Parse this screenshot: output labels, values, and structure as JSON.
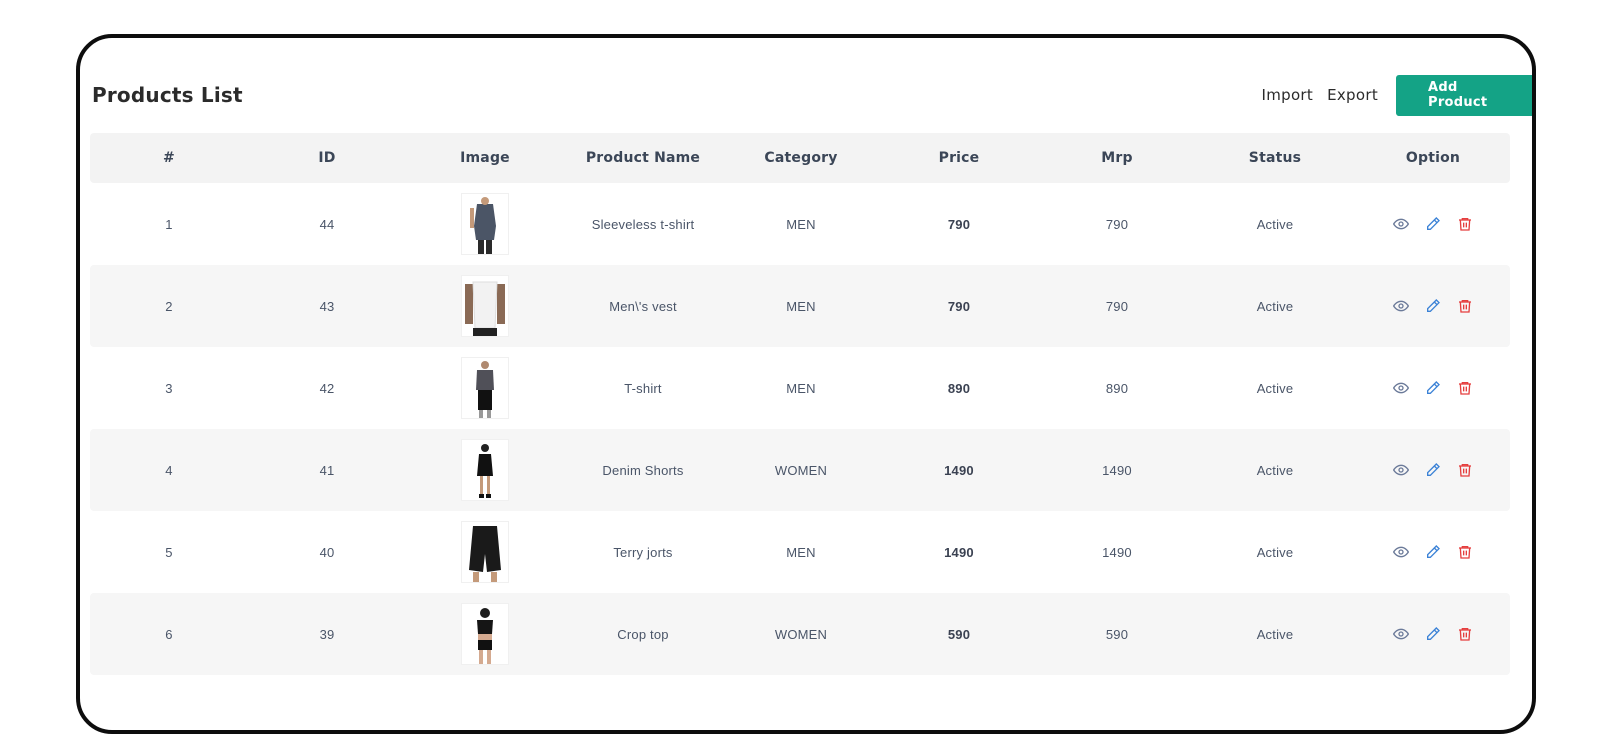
{
  "header": {
    "title": "Products List",
    "import_label": "Import",
    "export_label": "Export",
    "add_label": "Add Product"
  },
  "columns": [
    "#",
    "ID",
    "Image",
    "Product Name",
    "Category",
    "Price",
    "Mrp",
    "Status",
    "Option"
  ],
  "rows": [
    {
      "num": "1",
      "id": "44",
      "name": "Sleeveless t-shirt",
      "category": "MEN",
      "price": "790",
      "mrp": "790",
      "status": "Active"
    },
    {
      "num": "2",
      "id": "43",
      "name": "Men\\'s vest",
      "category": "MEN",
      "price": "790",
      "mrp": "790",
      "status": "Active"
    },
    {
      "num": "3",
      "id": "42",
      "name": "T-shirt",
      "category": "MEN",
      "price": "890",
      "mrp": "890",
      "status": "Active"
    },
    {
      "num": "4",
      "id": "41",
      "name": "Denim Shorts",
      "category": "WOMEN",
      "price": "1490",
      "mrp": "1490",
      "status": "Active"
    },
    {
      "num": "5",
      "id": "40",
      "name": "Terry jorts",
      "category": "MEN",
      "price": "1490",
      "mrp": "1490",
      "status": "Active"
    },
    {
      "num": "6",
      "id": "39",
      "name": "Crop top",
      "category": "WOMEN",
      "price": "590",
      "mrp": "590",
      "status": "Active"
    }
  ],
  "colors": {
    "accent": "#14a386",
    "view_icon": "#6b7a99",
    "edit_icon": "#3b82d6",
    "delete_icon": "#e53e3e"
  },
  "icons": [
    "eye-icon",
    "pencil-icon",
    "trash-icon"
  ]
}
